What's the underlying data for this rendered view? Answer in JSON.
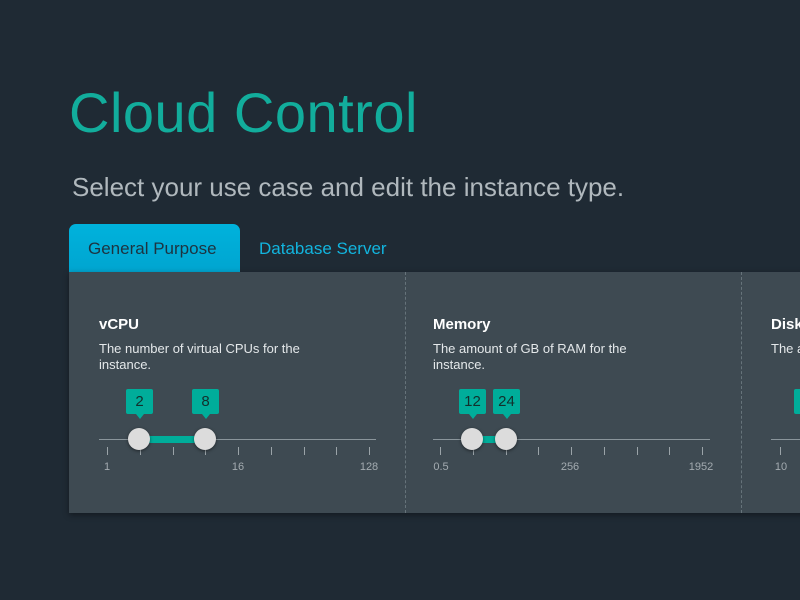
{
  "header": {
    "title": "Cloud Control",
    "subtitle": "Select your use case and edit the instance type."
  },
  "tabs": [
    {
      "label": "General Purpose",
      "active": true
    },
    {
      "label": "Database Server",
      "active": false
    }
  ],
  "colors": {
    "accent": "#00ad9a",
    "tab_active": "#00b2dc",
    "background": "#1f2a34",
    "panel": "#3e4a52"
  },
  "sliders": [
    {
      "title": "vCPU",
      "description": "The number of virtual CPUs for the instance.",
      "low": "2",
      "high": "8",
      "tick_labels": [
        "1",
        "16",
        "128"
      ]
    },
    {
      "title": "Memory",
      "description": "The amount of GB of RAM for the instance.",
      "low": "12",
      "high": "24",
      "tick_labels": [
        "0.5",
        "256",
        "1952"
      ]
    },
    {
      "title": "Disk",
      "description": "The a",
      "tick_labels": [
        "10"
      ]
    }
  ]
}
